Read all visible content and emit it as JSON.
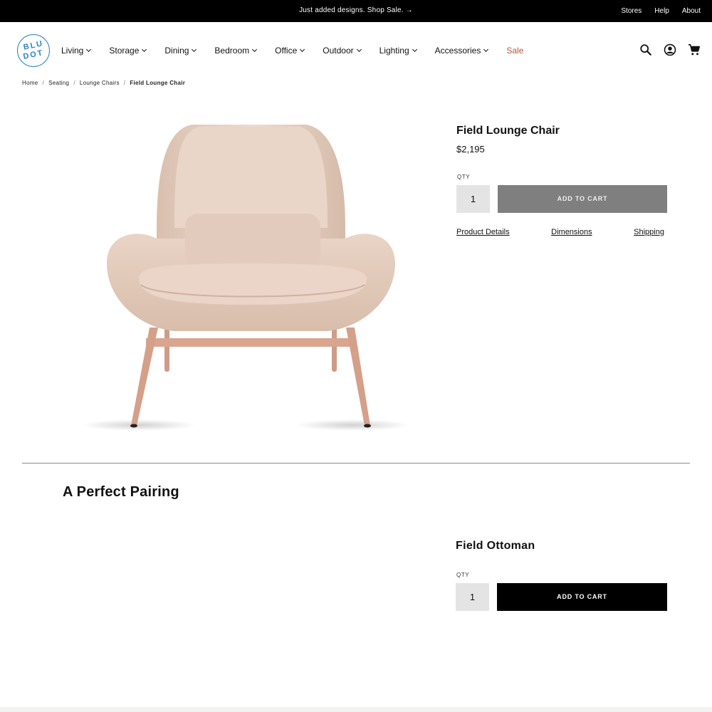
{
  "promo": {
    "text": "Just added designs. Shop Sale. →",
    "links": [
      "Stores",
      "Help",
      "About"
    ]
  },
  "brand": {
    "logo_line1": "BLU",
    "logo_line2": "DOT",
    "logo_color": "#2a84c7"
  },
  "nav": {
    "items": [
      {
        "label": "Living",
        "icon": "chevron-down-icon"
      },
      {
        "label": "Storage",
        "icon": "chevron-down-icon"
      },
      {
        "label": "Dining",
        "icon": "chevron-down-icon"
      },
      {
        "label": "Bedroom",
        "icon": "chevron-down-icon"
      },
      {
        "label": "Office",
        "icon": "chevron-down-icon"
      },
      {
        "label": "Outdoor",
        "icon": "chevron-down-icon"
      },
      {
        "label": "Lighting",
        "icon": "chevron-down-icon"
      },
      {
        "label": "Accessories",
        "icon": "chevron-down-icon"
      }
    ],
    "sale_label": "Sale",
    "sale_color": "#b5553f",
    "icons": [
      "search-icon",
      "account-icon",
      "cart-icon"
    ]
  },
  "breadcrumb": {
    "items": [
      "Home",
      "Seating",
      "Lounge Chairs"
    ],
    "current": "Field Lounge Chair",
    "separator": "/"
  },
  "product": {
    "title": "Field Lounge Chair",
    "price": "$2,195",
    "qty_label": "QTY",
    "qty_value": "1",
    "add_to_cart": "ADD TO CART",
    "links": [
      "Product Details",
      "Dimensions",
      "Shipping"
    ]
  },
  "pairing": {
    "heading": "A Perfect Pairing",
    "title": "Field Ottoman",
    "qty_label": "QTY",
    "qty_value": "1",
    "add_to_cart": "ADD TO CART"
  }
}
